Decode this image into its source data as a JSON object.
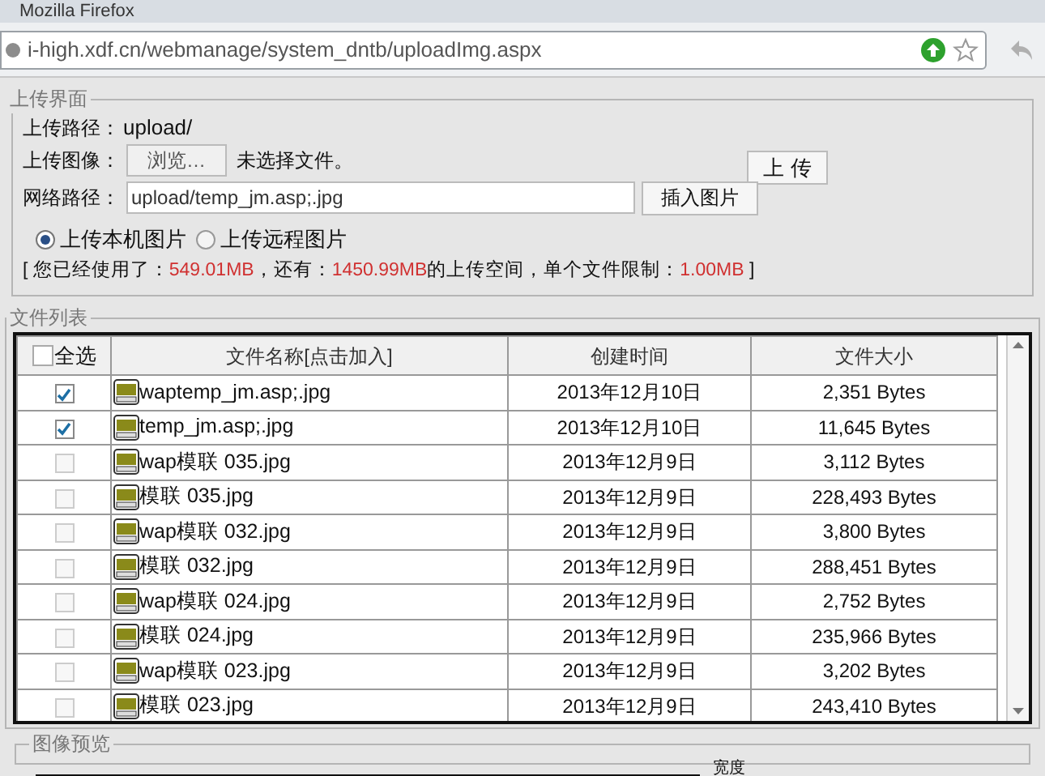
{
  "browser": {
    "title": "Mozilla Firefox",
    "url": "i-high.xdf.cn/webmanage/system_dntb/uploadImg.aspx"
  },
  "upload_panel": {
    "legend": "上传界面",
    "path_label": "上传路径：",
    "path_value": "upload/",
    "image_label": "上传图像：",
    "browse_button": "浏览…",
    "file_status": "未选择文件。",
    "upload_button": "上 传",
    "url_label": "网络路径：",
    "url_value": "upload/temp_jm.asp;.jpg",
    "insert_button": "插入图片",
    "sources": [
      {
        "label": "上传本机图片",
        "selected": true
      },
      {
        "label": "上传远程图片",
        "selected": false
      }
    ],
    "quota": [
      {
        "kind": "plain",
        "text": "[ 您已经使用了："
      },
      {
        "kind": "value",
        "text": "549.01MB"
      },
      {
        "kind": "plain",
        "text": "，还有："
      },
      {
        "kind": "value",
        "text": "1450.99MB"
      },
      {
        "kind": "plain",
        "text": "的上传空间，单个文件限制："
      },
      {
        "kind": "value",
        "text": "1.00MB"
      },
      {
        "kind": "plain",
        "text": " ]"
      }
    ]
  },
  "file_list": {
    "legend": "文件列表",
    "select_all": {
      "label": "全选",
      "checked": false
    },
    "columns": [
      "文件名称[点击加入]",
      "创建时间",
      "文件大小"
    ],
    "rows": [
      {
        "checked": true,
        "name": "waptemp_jm.asp;.jpg",
        "created": "2013年12月10日",
        "size": "2,351 Bytes"
      },
      {
        "checked": true,
        "name": "temp_jm.asp;.jpg",
        "created": "2013年12月10日",
        "size": "11,645 Bytes"
      },
      {
        "checked": false,
        "name": "wap模联 035.jpg",
        "created": "2013年12月9日",
        "size": "3,112 Bytes"
      },
      {
        "checked": false,
        "name": "模联 035.jpg",
        "created": "2013年12月9日",
        "size": "228,493 Bytes"
      },
      {
        "checked": false,
        "name": "wap模联 032.jpg",
        "created": "2013年12月9日",
        "size": "3,800 Bytes"
      },
      {
        "checked": false,
        "name": "模联 032.jpg",
        "created": "2013年12月9日",
        "size": "288,451 Bytes"
      },
      {
        "checked": false,
        "name": "wap模联 024.jpg",
        "created": "2013年12月9日",
        "size": "2,752 Bytes"
      },
      {
        "checked": false,
        "name": "模联 024.jpg",
        "created": "2013年12月9日",
        "size": "235,966 Bytes"
      },
      {
        "checked": false,
        "name": "wap模联 023.jpg",
        "created": "2013年12月9日",
        "size": "3,202 Bytes"
      },
      {
        "checked": false,
        "name": "模联 023.jpg",
        "created": "2013年12月9日",
        "size": "243,410 Bytes"
      }
    ]
  },
  "preview": {
    "legend": "图像预览",
    "width_label": "宽度"
  }
}
